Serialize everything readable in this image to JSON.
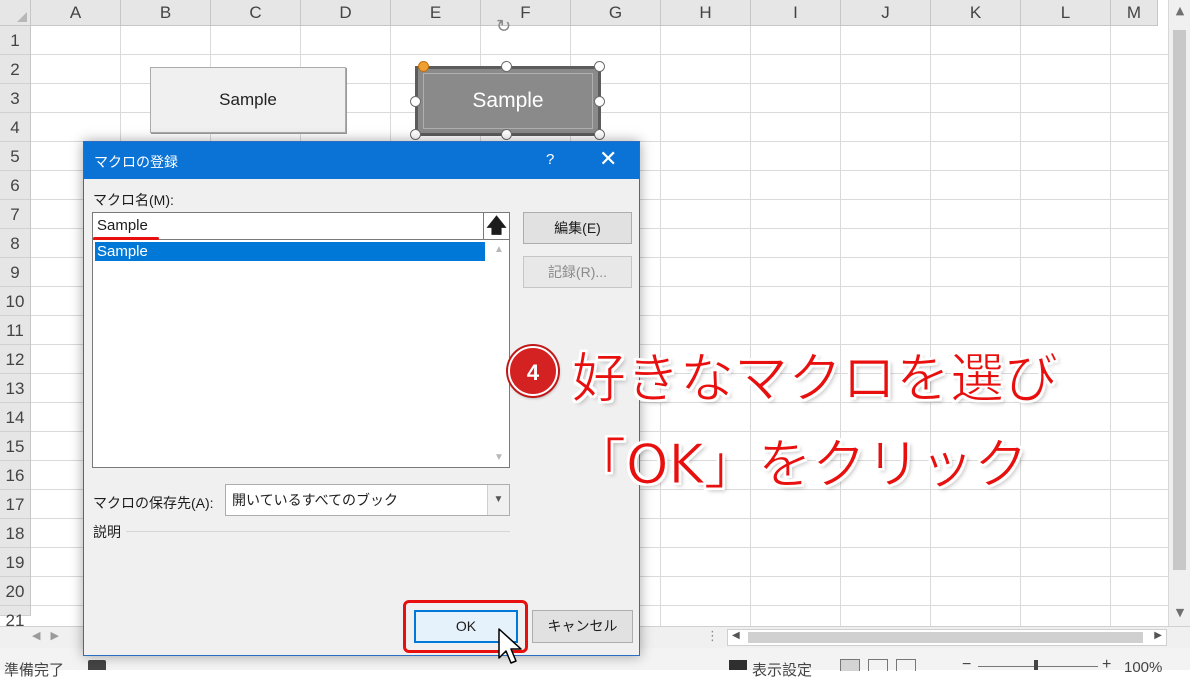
{
  "sheet": {
    "columns": [
      "A",
      "B",
      "C",
      "D",
      "E",
      "F",
      "G",
      "H",
      "I",
      "J",
      "K",
      "L",
      "M"
    ],
    "rows": [
      "1",
      "2",
      "3",
      "4",
      "5",
      "6",
      "7",
      "8",
      "9",
      "10",
      "11",
      "12",
      "13",
      "14",
      "15",
      "16",
      "17",
      "18",
      "19",
      "20",
      "21"
    ],
    "button1_label": "Sample",
    "button2_label": "Sample"
  },
  "dialog": {
    "title": "マクロの登録",
    "help": "?",
    "close": "✕",
    "macro_name_label": "マクロ名(M):",
    "macro_name_value": "Sample",
    "up_arrow": "🡅",
    "list_items": [
      "Sample"
    ],
    "edit_button": "編集(E)",
    "record_button": "記録(R)...",
    "store_label": "マクロの保存先(A):",
    "store_value": "開いているすべてのブック",
    "description_label": "説明",
    "ok_button": "OK",
    "cancel_button": "キャンセル"
  },
  "annotation": {
    "step_number": "4",
    "line1": "好きなマクロを選び",
    "line2": "「OK」をクリック",
    "color": "#e8100e"
  },
  "statusbar": {
    "ready": "準備完了",
    "display_settings": "表示設定",
    "zoom": "100%"
  }
}
